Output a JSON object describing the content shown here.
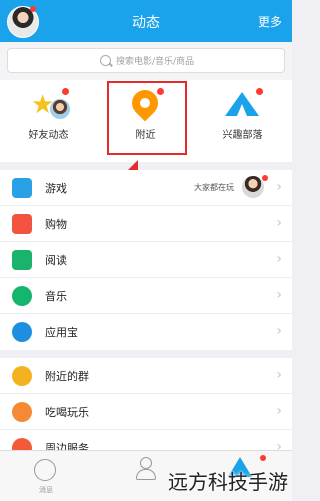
{
  "header": {
    "title": "动态",
    "more": "更多"
  },
  "search": {
    "placeholder": "搜索电影/音乐/商品"
  },
  "feed": {
    "items": [
      {
        "label": "好友动态",
        "icon": "friends-star-icon"
      },
      {
        "label": "附近",
        "icon": "location-pin-icon"
      },
      {
        "label": "兴趣部落",
        "icon": "tent-icon"
      }
    ]
  },
  "list1": {
    "items": [
      {
        "label": "游戏",
        "icon": "gamepad-icon",
        "color": "#2aa1e6",
        "side": "大家都在玩"
      },
      {
        "label": "购物",
        "icon": "shopping-bag-icon",
        "color": "#f35440"
      },
      {
        "label": "阅读",
        "icon": "book-icon",
        "color": "#1ab36b"
      },
      {
        "label": "音乐",
        "icon": "music-icon",
        "color": "#16b56e"
      },
      {
        "label": "应用宝",
        "icon": "app-store-icon",
        "color": "#1e8fe0"
      }
    ]
  },
  "list2": {
    "items": [
      {
        "label": "附近的群",
        "icon": "nearby-group-icon",
        "color": "#f3b221"
      },
      {
        "label": "吃喝玩乐",
        "icon": "food-icon",
        "color": "#f68a34"
      },
      {
        "label": "周边服务",
        "icon": "service-icon",
        "color": "#f45a3a"
      }
    ]
  },
  "tabbar": {
    "messages": "消息"
  },
  "watermark": "远方科技手游",
  "colors": {
    "accent": "#1aa3ea",
    "highlight": "#e52b2b"
  }
}
